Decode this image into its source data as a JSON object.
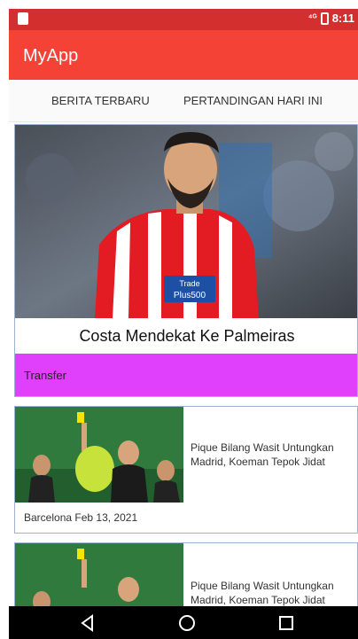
{
  "status_bar": {
    "time": "8:11",
    "signal_label": "⁴ᴳ"
  },
  "app_bar": {
    "title": "MyApp"
  },
  "tabs": [
    {
      "label": "BERITA TERBARU"
    },
    {
      "label": "PERTANDINGAN HARI INI"
    }
  ],
  "featured": {
    "title": "Costa Mendekat Ke Palmeiras",
    "category": "Transfer",
    "category_color": "#e040fb"
  },
  "news": [
    {
      "title": "Pique Bilang Wasit Untungkan Madrid, Koeman Tepok Jidat",
      "tag": "Barcelona",
      "date": "Feb 13, 2021"
    },
    {
      "title": "Pique Bilang Wasit Untungkan Madrid, Koeman Tepok Jidat"
    }
  ],
  "colors": {
    "status_bar": "#d32f2f",
    "app_bar": "#f44336",
    "accent": "#e040fb"
  },
  "nav_bar": {
    "icons": [
      "back-icon",
      "home-icon",
      "recents-icon"
    ]
  }
}
